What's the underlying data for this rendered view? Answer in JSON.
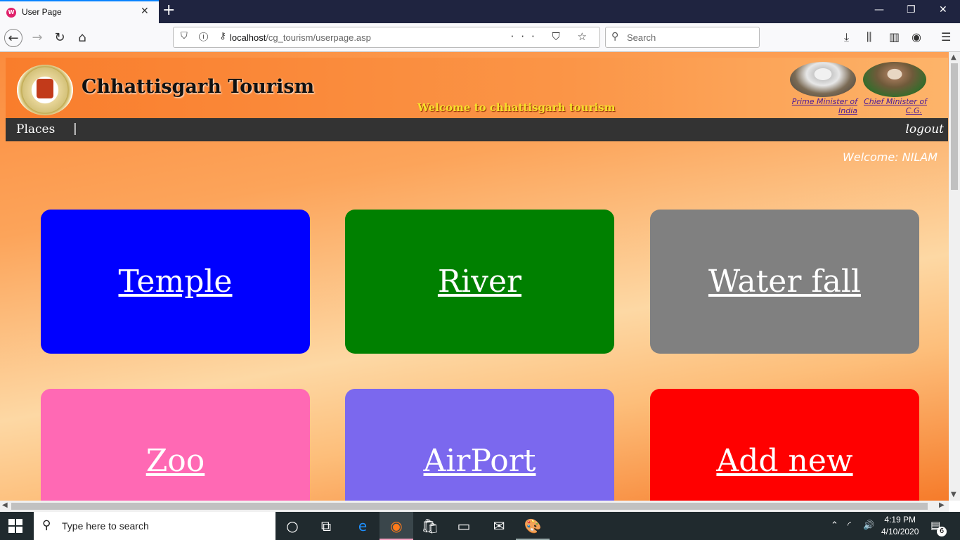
{
  "browser": {
    "tab_title": "User Page",
    "tab_favicon": "W",
    "url_host": "localhost",
    "url_path": "/cg_tourism/userpage.asp",
    "search_placeholder": "Search"
  },
  "site": {
    "title": "Chhattisgarh Tourism",
    "welcome_marquee": "Welcome to chhattisgarh tourism",
    "pm_link_line1": "Prime Minister of",
    "pm_link_line2": "India",
    "cm_link_line1": "Chief Minister of",
    "cm_link_line2": "C.G."
  },
  "menu": {
    "places": "Places",
    "separator": "|",
    "logout": "logout"
  },
  "user": {
    "welcome": "Welcome:  NILAM"
  },
  "cards": [
    {
      "label": "Temple",
      "color": "#0000ff"
    },
    {
      "label": "River",
      "color": "#008000"
    },
    {
      "label": "Water fall",
      "color": "#808080"
    },
    {
      "label": "Zoo",
      "color": "#ff69b4"
    },
    {
      "label": "AirPort",
      "color": "#7b68ee"
    },
    {
      "label": "Add new",
      "color": "#ff0000"
    }
  ],
  "taskbar": {
    "search_text": "Type here to search",
    "time": "4:19 PM",
    "date": "4/10/2020",
    "notification_count": "6"
  }
}
